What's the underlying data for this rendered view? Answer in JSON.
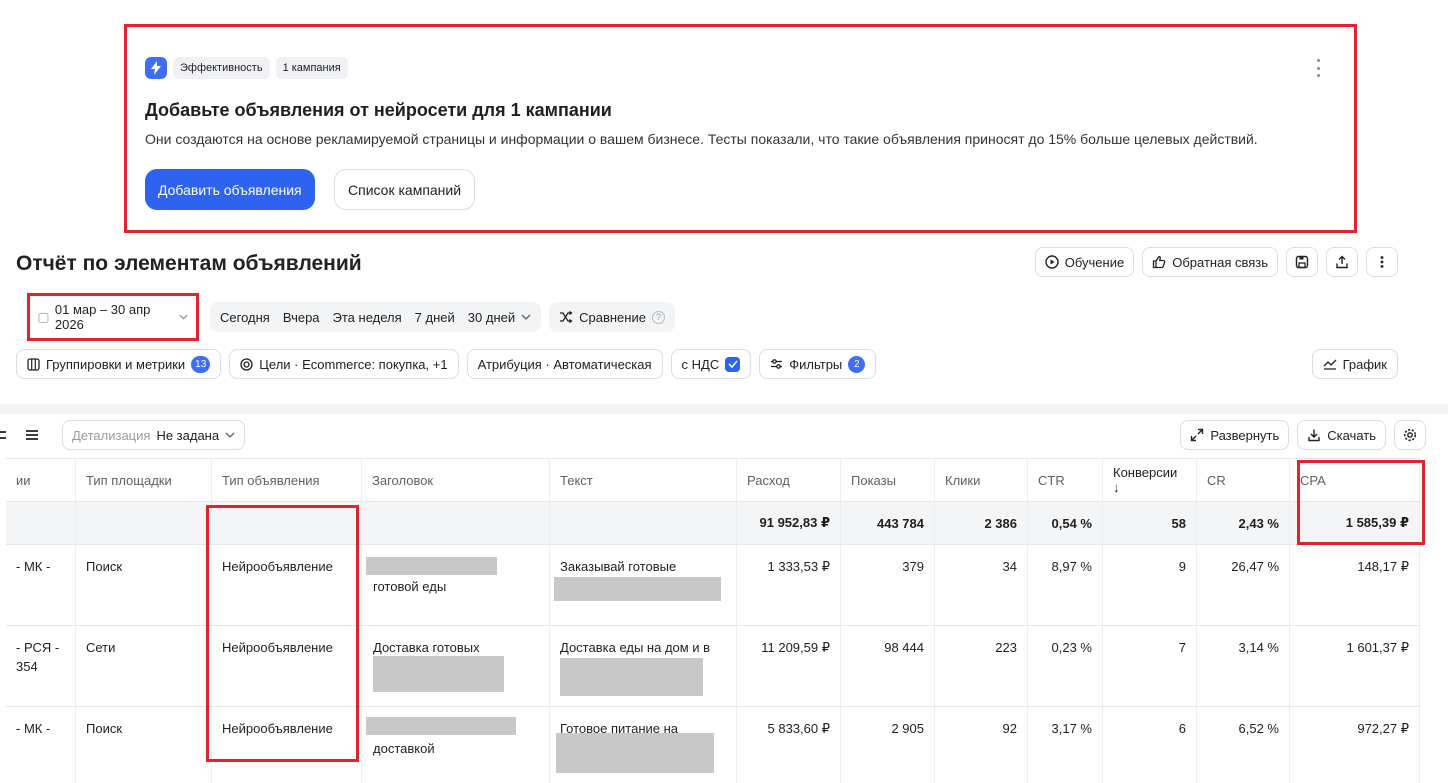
{
  "colors": {
    "accent": "#2d63ee",
    "highlight_border": "#e0242b",
    "badge": "#3d6ef5"
  },
  "promo": {
    "icon": "lightning-icon",
    "badge_category": "Эффективность",
    "badge_count": "1 кампания",
    "title": "Добавьте объявления от нейросети для 1 кампании",
    "description": "Они создаются на основе рекламируемой страницы и информации о вашем бизнесе. Тесты показали, что такие объявления приносят до 15% больше целевых действий.",
    "primary_button": "Добавить объявления",
    "secondary_button": "Список кампаний"
  },
  "page": {
    "title": "Отчёт по элементам объявлений"
  },
  "top_actions": {
    "learning": "Обучение",
    "feedback": "Обратная связь"
  },
  "date_range": {
    "value": "01 мар – 30 апр 2026"
  },
  "quick_periods": [
    "Сегодня",
    "Вчера",
    "Эта неделя",
    "7 дней",
    "30 дней"
  ],
  "comparison": "Сравнение",
  "filters": {
    "groupings": "Группировки и метрики",
    "groupings_count": "13",
    "goals": "Цели · Ecommerce: покупка, +1",
    "attribution": "Атрибуция · Автоматическая",
    "vat": "с НДС",
    "filters": "Фильтры",
    "filters_count": "2",
    "graph": "График"
  },
  "table_toolbar": {
    "detail_label": "Детализация",
    "detail_value": "Не задана",
    "expand": "Развернуть",
    "download": "Скачать"
  },
  "table": {
    "columns": [
      "ии",
      "Тип площадки",
      "Тип объявления",
      "Заголовок",
      "Текст",
      "Расход",
      "Показы",
      "Клики",
      "CTR",
      "Конверсии ↓",
      "CR",
      "CPA"
    ],
    "totals": [
      "",
      "",
      "",
      "",
      "",
      "91 952,83 ₽",
      "443 784",
      "2 386",
      "0,54 %",
      "58",
      "2,43 %",
      "1 585,39 ₽"
    ],
    "rows": [
      {
        "campaign": "- МК -",
        "platform": "Поиск",
        "ad_type": "Нейрообъявление",
        "headline": "готовой еды",
        "text": "Заказывай готовые",
        "spend": "1 333,53 ₽",
        "impressions": "379",
        "clicks": "34",
        "ctr": "8,97 %",
        "conversions": "9",
        "cr": "26,47 %",
        "cpa": "148,17 ₽"
      },
      {
        "campaign": "- РСЯ -",
        "campaign_line2": "354",
        "platform": "Сети",
        "ad_type": "Нейрообъявление",
        "headline": "Доставка готовых",
        "text": "Доставка еды на дом и в",
        "spend": "11 209,59 ₽",
        "impressions": "98 444",
        "clicks": "223",
        "ctr": "0,23 %",
        "conversions": "7",
        "cr": "3,14 %",
        "cpa": "1 601,37 ₽"
      },
      {
        "campaign": "- МК -",
        "platform": "Поиск",
        "ad_type": "Нейрообъявление",
        "headline": "доставкой",
        "text": "Готовое питание на",
        "spend": "5 833,60 ₽",
        "impressions": "2 905",
        "clicks": "92",
        "ctr": "3,17 %",
        "conversions": "6",
        "cr": "6,52 %",
        "cpa": "972,27 ₽"
      }
    ]
  }
}
